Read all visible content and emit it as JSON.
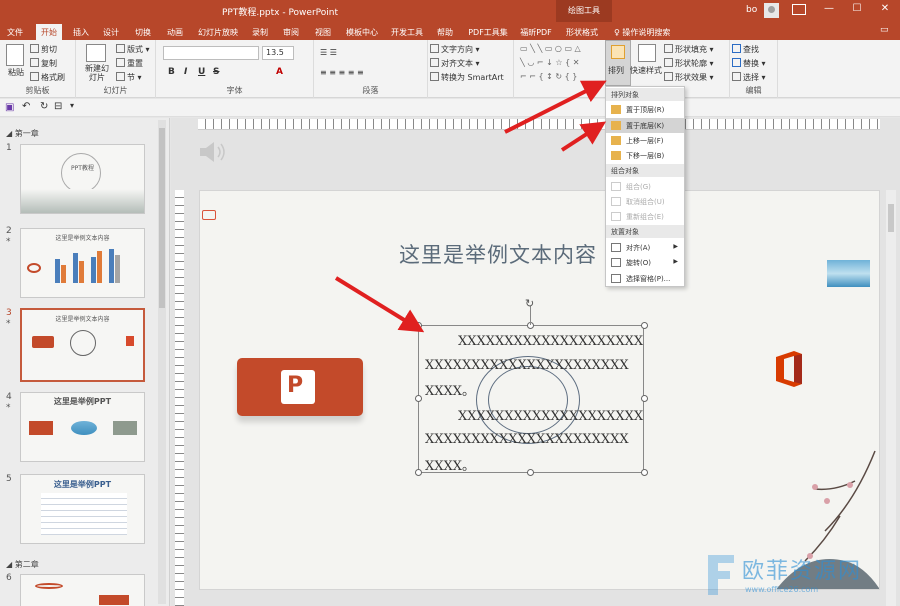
{
  "window": {
    "title": "PPT教程.pptx - PowerPoint",
    "context_tab": "绘图工具",
    "user": "bo"
  },
  "tabs": [
    "文件",
    "开始",
    "插入",
    "设计",
    "切换",
    "动画",
    "幻灯片放映",
    "录制",
    "审阅",
    "视图",
    "模板中心",
    "开发工具",
    "帮助",
    "PDF工具集",
    "福昕PDF",
    "形状格式"
  ],
  "tabs_active": "开始",
  "tell_me": "操作说明搜索",
  "ribbon": {
    "clipboard": {
      "paste": "粘贴",
      "cut": "剪切",
      "copy": "复制",
      "format_painter": "格式刷",
      "label": "剪贴板"
    },
    "slides": {
      "new_slide": "新建幻灯片",
      "layout": "版式",
      "reset": "重置",
      "section": "节",
      "label": "幻灯片"
    },
    "font": {
      "size": "13.5",
      "bold": "B",
      "italic": "I",
      "underline": "U",
      "strike": "S",
      "label": "字体"
    },
    "paragraph": {
      "label": "段落"
    },
    "text_direction": "文字方向",
    "align_text": "对齐文本",
    "smartart": "转换为 SmartArt",
    "drawing": {
      "arrange": "排列",
      "quick_styles": "快速样式",
      "shape_fill": "形状填充",
      "shape_outline": "形状轮廓",
      "shape_effects": "形状效果"
    },
    "editing": {
      "find": "查找",
      "replace": "替换",
      "select": "选择",
      "label": "编辑"
    }
  },
  "thumbs": {
    "section1": "第一章",
    "section2": "第二章",
    "slides": [
      {
        "num": "1",
        "title": "PPT教程"
      },
      {
        "num": "2",
        "title": "这里是举例文本内容"
      },
      {
        "num": "3",
        "title": "这里是举例文本内容"
      },
      {
        "num": "4",
        "title": "这里是举例PPT"
      },
      {
        "num": "5",
        "title": "这里是举例PPT"
      },
      {
        "num": "6",
        "title": ""
      }
    ],
    "selected": "3"
  },
  "slide": {
    "title": "这里是举例文本内容",
    "text_lines": [
      "XXXXXXXXXXXXXXXXXXXX",
      "XXXXXXXXXXXXXXXXXXXXXX",
      "XXXX。",
      "XXXXXXXXXXXXXXXXXXXX",
      "XXXXXXXXXXXXXXXXXXXXXX",
      "XXXX。"
    ]
  },
  "menu": {
    "head_order": "排列对象",
    "bring_front": "置于顶层(R)",
    "send_back": "置于底层(K)",
    "bring_forward": "上移一层(F)",
    "send_backward": "下移一层(B)",
    "head_group": "组合对象",
    "group": "组合(G)",
    "ungroup": "取消组合(U)",
    "regroup": "重新组合(E)",
    "head_position": "放置对象",
    "align": "对齐(A)",
    "rotate": "旋转(O)",
    "selection_pane": "选择窗格(P)..."
  },
  "watermark": {
    "text": "欧菲资源网",
    "url": "www.office26.com"
  }
}
